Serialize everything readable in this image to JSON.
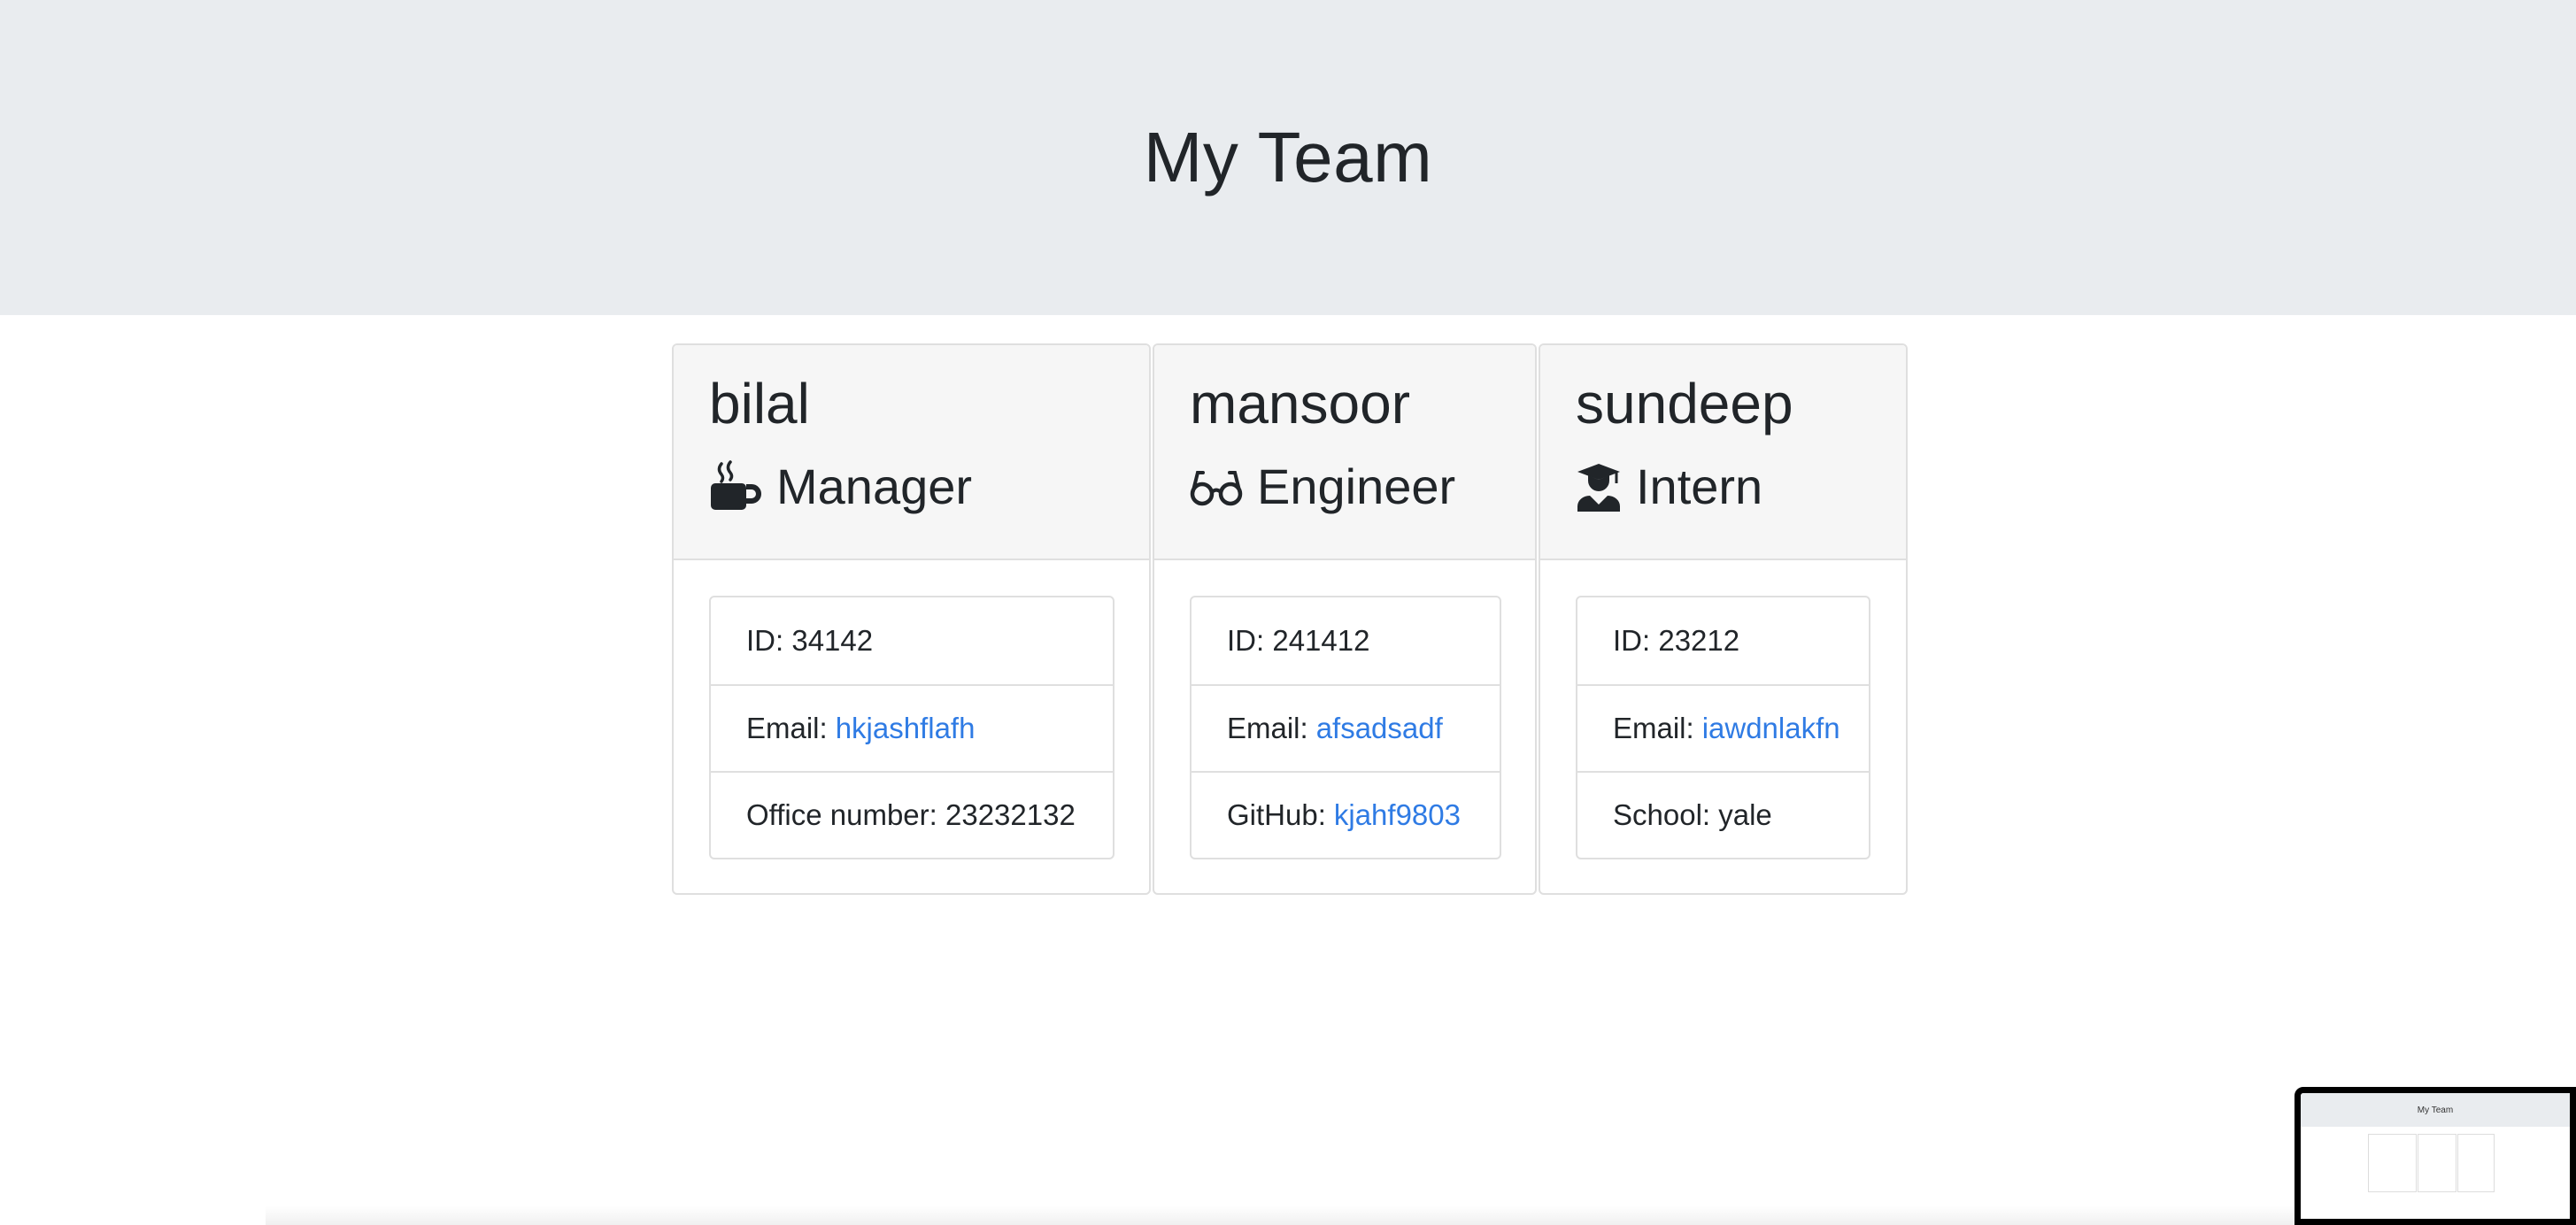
{
  "page": {
    "title": "My Team"
  },
  "team": [
    {
      "name": "bilal",
      "role": "Manager",
      "role_icon": "mug-hot-icon",
      "id_label": "ID: 34142",
      "email_label": "Email:",
      "email": "hkjashflafh",
      "extra_label": "Office number: 23232132",
      "extra_link": ""
    },
    {
      "name": "mansoor",
      "role": "Engineer",
      "role_icon": "glasses-icon",
      "id_label": "ID: 241412",
      "email_label": "Email:",
      "email": "afsadsadf",
      "extra_label": "GitHub:",
      "extra_link": "kjahf9803"
    },
    {
      "name": "sundeep",
      "role": "Intern",
      "role_icon": "graduate-icon",
      "id_label": "ID: 23212",
      "email_label": "Email:",
      "email": "iawdnlakfn",
      "extra_label": "School: yale",
      "extra_link": ""
    }
  ],
  "colors": {
    "header_bg": "#e9ecef",
    "link": "#2f7be4",
    "card_header_bg": "#f6f6f6",
    "border": "#dfdfdf"
  },
  "thumbnail": {
    "title": "My Team"
  }
}
